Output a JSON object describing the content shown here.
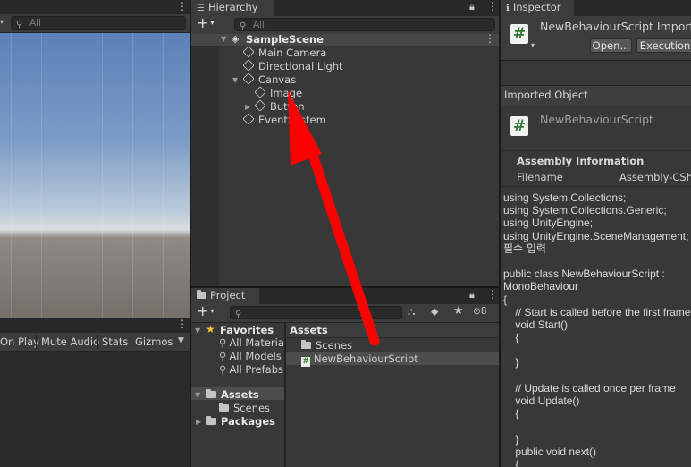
{
  "scene_view": {
    "search_placeholder": "All",
    "toolbar_buttons": [
      "On Play",
      "Mute Audio",
      "Stats",
      "Gizmos"
    ]
  },
  "hierarchy": {
    "tab_label": "Hierarchy",
    "add_label": "+",
    "search_placeholder": "All",
    "items": [
      {
        "label": "SampleScene",
        "icon": "unity-scene-icon",
        "expanded": true,
        "bold": true
      },
      {
        "label": "Main Camera",
        "icon": "gameobject-cube-icon"
      },
      {
        "label": "Directional Light",
        "icon": "gameobject-cube-icon"
      },
      {
        "label": "Canvas",
        "icon": "gameobject-cube-icon",
        "expanded": true
      },
      {
        "label": "Image",
        "icon": "gameobject-cube-icon"
      },
      {
        "label": "Button",
        "icon": "gameobject-cube-icon",
        "collapsed": true
      },
      {
        "label": "EventSystem",
        "icon": "gameobject-cube-icon"
      }
    ]
  },
  "project": {
    "tab_label": "Project",
    "add_label": "+",
    "hidden_count": "8",
    "sidebar": {
      "favorites_label": "Favorites",
      "favorites": [
        "All Materia",
        "All Models",
        "All Prefabs"
      ],
      "assets_label": "Assets",
      "assets_children": [
        "Scenes"
      ],
      "packages_label": "Packages"
    },
    "breadcrumb": "Assets",
    "files": [
      {
        "label": "Scenes",
        "icon": "folder-icon"
      },
      {
        "label": "NewBehaviourScript",
        "icon": "csharp-script-icon",
        "selected": true
      }
    ]
  },
  "inspector": {
    "tab_label": "Inspector",
    "title": "NewBehaviourScript Import S",
    "open_label": "Open...",
    "execution_label": "Execution",
    "imported_object_label": "Imported Object",
    "object_name": "NewBehaviourScript",
    "assembly_header": "Assembly Information",
    "filename_label": "Filename",
    "filename_value": "Assembly-CSh",
    "code_lines": [
      "using System.Collections;",
      "using System.Collections.Generic;",
      "using UnityEngine;",
      "using UnityEngine.SceneManagement; /",
      "필수 입력",
      "",
      "public class NewBehaviourScript :",
      "MonoBehaviour",
      "{",
      "    // Start is called before the first frame",
      "    void Start()",
      "    {",
      "",
      "    }",
      "",
      "    // Update is called once per frame",
      "    void Update()",
      "    {",
      "",
      "    }",
      "    public void next()",
      "    {"
    ]
  },
  "colors": {
    "panel_bg": "#383838",
    "tab_bar": "#282828",
    "selection": "#4d4d4d",
    "arrow_red": "#ff0000",
    "script_icon_green": "#2f7a33"
  }
}
